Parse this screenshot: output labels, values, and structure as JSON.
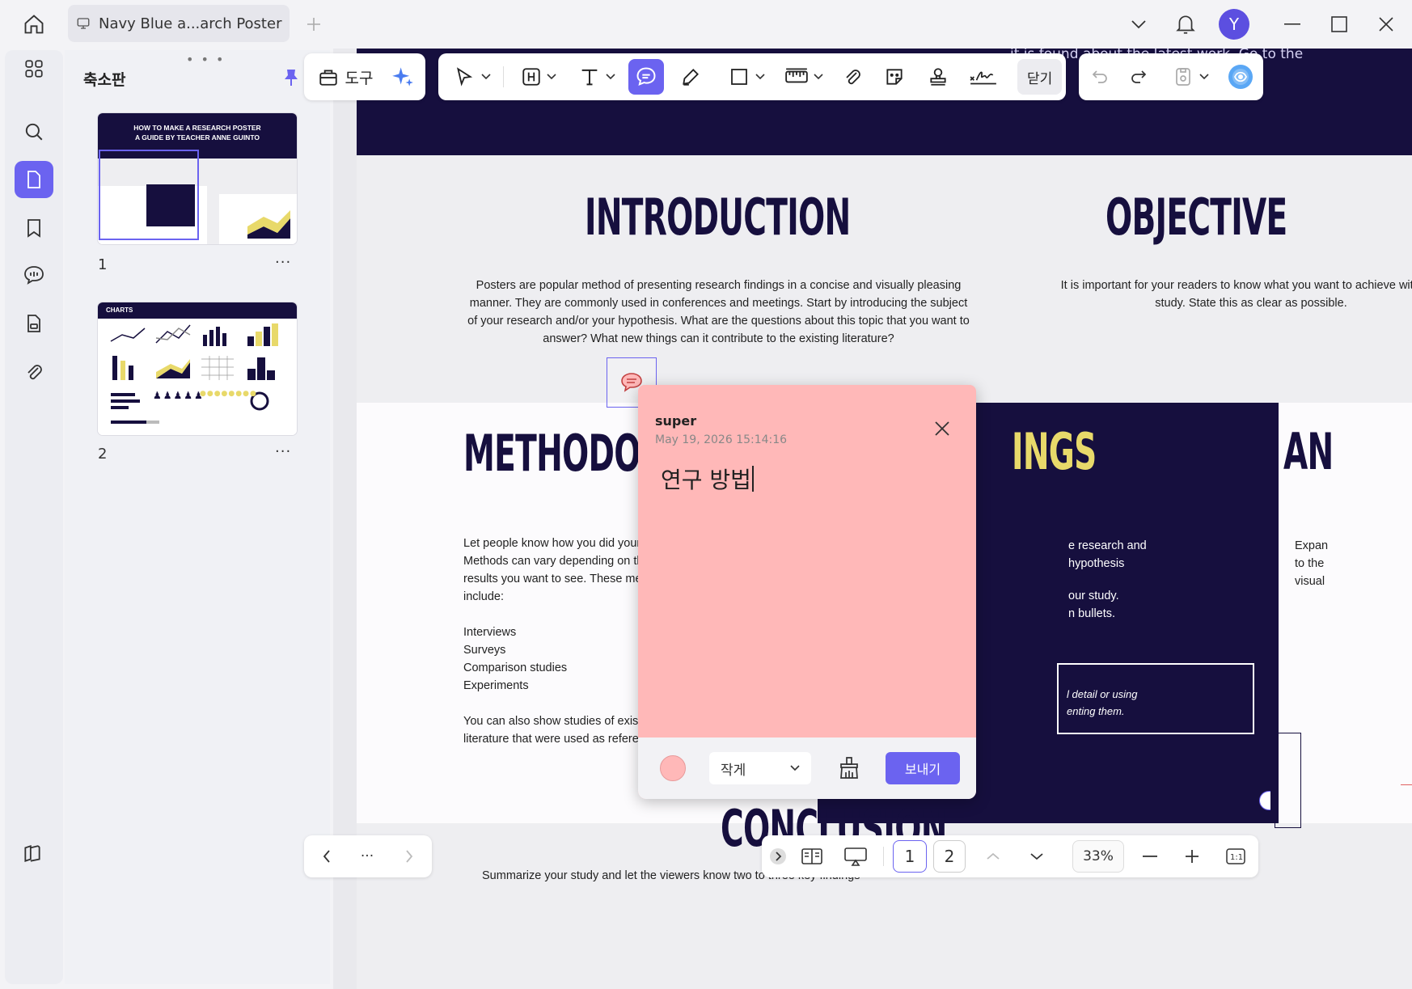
{
  "titlebar": {
    "tab_title": "Navy Blue a...arch Poster",
    "avatar_letter": "Y"
  },
  "panel": {
    "title": "축소판",
    "pages": [
      {
        "number": "1",
        "more": "···"
      },
      {
        "number": "2",
        "more": "···"
      }
    ]
  },
  "toolbar": {
    "tools_label": "도구",
    "close_label": "닫기"
  },
  "poster": {
    "band_text": "it is found about the latest work. Go to the",
    "intro_title": "INTRODUCTION",
    "intro_text": "Posters are popular method of presenting research findings in a concise and visually pleasing manner. They are commonly used in conferences and meetings. Start by introducing the subject of your research and/or your hypothesis. What are the questions about this topic that you want to answer? What new things can it contribute to the existing literature?",
    "objective_title": "OBJECTIVE",
    "objective_text": "It is important for your readers to know what you want to achieve with this study. State this as clear as possible.",
    "methodology_title": "METHODOLOGY",
    "methodology_intro": "Let people know how you did your study. Methods can vary depending on the subject or results you want to see. These methods can include:",
    "methodology_items": [
      "Interviews",
      "Surveys",
      "Comparison studies",
      "Experiments"
    ],
    "methodology_outro": "You can also show studies of existing literature that were used as references.",
    "findings_title": "INGS",
    "findings_line1": "e research and",
    "findings_line2": "hypothesis",
    "findings_line3": "our study.",
    "findings_line4": "n bullets.",
    "findings_quote1": "l detail or using",
    "findings_quote2": "enting them.",
    "analysis_title": "AN",
    "analysis_line1": "Expan",
    "analysis_line2": "to the",
    "analysis_line3": "visual",
    "conclusion_title": "CONCLUSION",
    "conclusion_text": "Summarize your study and let the viewers know two to three key findings"
  },
  "thumb1": {
    "title_line1": "HOW TO MAKE A RESEARCH POSTER",
    "title_line2": "A GUIDE BY TEACHER ANNE GUINTO"
  },
  "thumb2": {
    "header": "CHARTS"
  },
  "note": {
    "author": "super",
    "date": "May 19, 2026 15:14:16",
    "body": "연구 방법",
    "color": "#ffb8b8",
    "size_label": "작게",
    "send_label": "보내기"
  },
  "bottombar": {
    "more": "···",
    "page1": "1",
    "page2": "2",
    "zoom": "33%"
  },
  "colors": {
    "accent": "#6b63f0",
    "navy": "#160f3e"
  }
}
